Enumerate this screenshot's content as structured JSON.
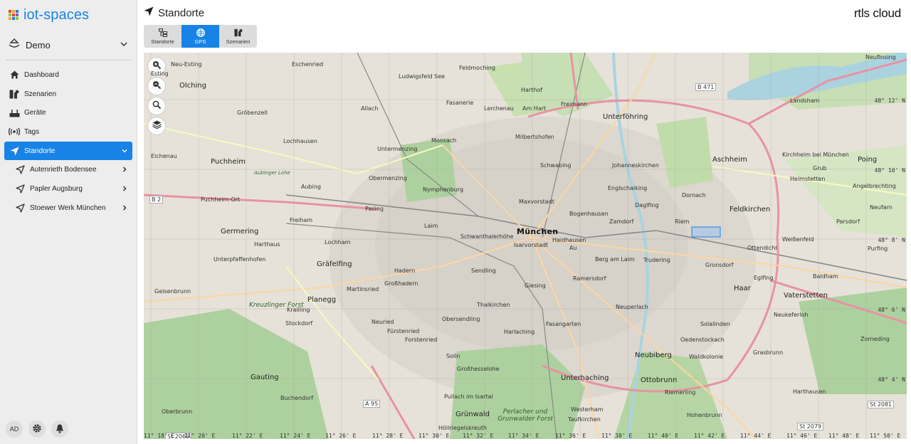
{
  "app": {
    "name": "iot-spaces",
    "logo_text": "rtls cloud",
    "brand_colors": [
      "#e8413c",
      "#f5a623",
      "#1883e6",
      "#7ed321",
      "#e8413c",
      "#9b59b6",
      "#f5a623",
      "#1883e6",
      "#7ed321"
    ],
    "accent": "#1883e6"
  },
  "workspace": {
    "label": "Demo"
  },
  "nav": {
    "items": [
      {
        "label": "Dashboard",
        "icon": "home-icon"
      },
      {
        "label": "Szenarien",
        "icon": "scenarios-icon"
      },
      {
        "label": "Geräte",
        "icon": "devices-icon"
      },
      {
        "label": "Tags",
        "icon": "tags-icon"
      },
      {
        "label": "Standorte",
        "icon": "location-arrow-icon",
        "active": true
      }
    ],
    "sub_items": [
      {
        "label": "Autenrieth Bodensee"
      },
      {
        "label": "Papler Augsburg"
      },
      {
        "label": "Stoewer Werk München"
      }
    ]
  },
  "footer": {
    "avatar": "AD"
  },
  "page": {
    "title": "Standorte"
  },
  "view_tabs": [
    {
      "label": "Standorte",
      "icon": "hierarchy-icon"
    },
    {
      "label": "GPS",
      "icon": "globe-icon",
      "active": true
    },
    {
      "label": "Szenarien",
      "icon": "scenarios-icon"
    }
  ],
  "map": {
    "labels": {
      "olching": "Olching",
      "neu_esting": "Neu-Esting",
      "esting": "Esting",
      "grobenzell": "Gröbenzell",
      "eschenried": "Eschenried",
      "ludwigsfeld": "Ludwigsfeld",
      "feldmoching": "Feldmoching",
      "harthof": "Harthof",
      "allach": "Allach",
      "fasanerie": "Fasanerie",
      "lerchenau": "Lerchenau",
      "am_hart": "Am Hart",
      "freimann": "Freimann",
      "unterfohring": "Unterföhring",
      "lochhausen": "Lochhausen",
      "untermenzing": "Untermenzing",
      "moosach": "Moosach",
      "milbertshofen": "Milbertshofen",
      "schwabing": "Schwabing",
      "johanneskirchen": "Johanneskirchen",
      "aschheim": "Aschheim",
      "kirchheim": "Kirchheim bei München",
      "puchheim": "Puchheim",
      "eichenau": "Eichenau",
      "obermenzing": "Obermenzing",
      "nymphenburg": "Nymphenburg",
      "englschalking": "Englschalking",
      "aubing": "Aubing",
      "maxvorstadt": "Maxvorstadt",
      "bogenhausen": "Bogenhausen",
      "dornach": "Dornach",
      "dagfing": "Daglfing",
      "feldkirchen": "Feldkirchen",
      "puchheim_ort": "Puchheim-Ort",
      "pasing": "Pasing",
      "freiham": "Freiham",
      "laim": "Laim",
      "schwanthalerhohe": "Schwanthalerhöhe",
      "munchen": "München",
      "haidhausen": "Haidhausen",
      "zamdorf": "Zamdorf",
      "riem": "Riem",
      "germering": "Germering",
      "harthaus": "Harthaus",
      "lochham": "Lochham",
      "isarvorstadt": "Isarvorstadt",
      "au": "Au",
      "berg_am_laim": "Berg am Laim",
      "trudering": "Trudering",
      "ottendichl": "Ottendichl",
      "weissenfeld": "Weißenfeld",
      "unterpfaffenhofen": "Unterpfaffenhofen",
      "grafelfing": "Gräfelfing",
      "hadern": "Hadern",
      "sendling": "Sendling",
      "ramersdorf": "Ramersdorf",
      "gronsdorf": "Gronsdorf",
      "haar": "Haar",
      "vaterstetten": "Vaterstetten",
      "planegg": "Planegg",
      "martinsried": "Martinsried",
      "grosshadern": "Großhadern",
      "giesing": "Giesing",
      "thalkirchen": "Thalkirchen",
      "neuperlach": "Neuperlach",
      "krailling": "Krailling",
      "stockdorf": "Stockdorf",
      "neuried": "Neuried",
      "fursttenried": "Fürstenried",
      "obersendling": "Obersendling",
      "harlaching": "Harlaching",
      "fasangarten": "Fasangarten",
      "solalinden": "Solalinden",
      "forstenried": "Forstenried",
      "neubiberg": "Neubiberg",
      "oedenstockach": "Oedenstockach",
      "waldkolonie": "Waldkolonie",
      "solln": "Solln",
      "grosshesselohe": "Großhesselohe",
      "unterhaching": "Unterhaching",
      "ottobrunn": "Ottobrunn",
      "gauting": "Gauting",
      "buchendorf": "Buchendorf",
      "pullach": "Pullach im Isartal",
      "riemerling": "Riemerling",
      "grunwald": "Grünwald",
      "perlacher_forst": "Perlacher und Grunwalder Forst",
      "taufkirchen": "Taufkirchen",
      "hohenbrunn": "Hohenbrunn",
      "oberbrunn": "Oberbrunn",
      "landsham": "Landsham",
      "heimstetten": "Heimstetten",
      "poing": "Poing",
      "grub": "Grub",
      "angelbrechting": "Angelbrechting",
      "neufarn": "Neufarn",
      "parsdorf": "Parsdorf",
      "purfing": "Purfing",
      "baldham": "Baldham",
      "zorneding": "Zorneding",
      "grasbrunn": "Grasbrunn",
      "harthausen": "Harthausen",
      "neuching": "Neufinsing",
      "germering_west": "Geisenbrunn",
      "kreuzlinger": "Kreuzlinger Forst",
      "westerham": "Westerham",
      "hollriegelskreuth": "Höllriegelskreuth",
      "neukeferloh": "Neukeferloh",
      "egelfing": "Eglfing",
      "aubinger_lohe": "Aubinger Lohe",
      "b2": "B 2",
      "b471": "B 471",
      "a95": "A 95",
      "st2081": "St 2081",
      "st2079": "St 2079",
      "st2069": "St 2069",
      "see": "See"
    },
    "lat_ticks": [
      "48° 12' N",
      "48° 10' N",
      "48° 8' N",
      "48° 6' N",
      "48° 4' N"
    ],
    "lon_ticks": [
      "11° 18' E",
      "11° 20' E",
      "11° 22' E",
      "11° 24' E",
      "11° 26' E",
      "11° 28' E",
      "11° 30' E",
      "11° 32' E",
      "11° 34' E",
      "11° 36' E",
      "11° 38' E",
      "11° 40' E",
      "11° 42' E",
      "11° 44' E",
      "11° 46' E",
      "11° 48' E",
      "11° 50' E"
    ]
  }
}
